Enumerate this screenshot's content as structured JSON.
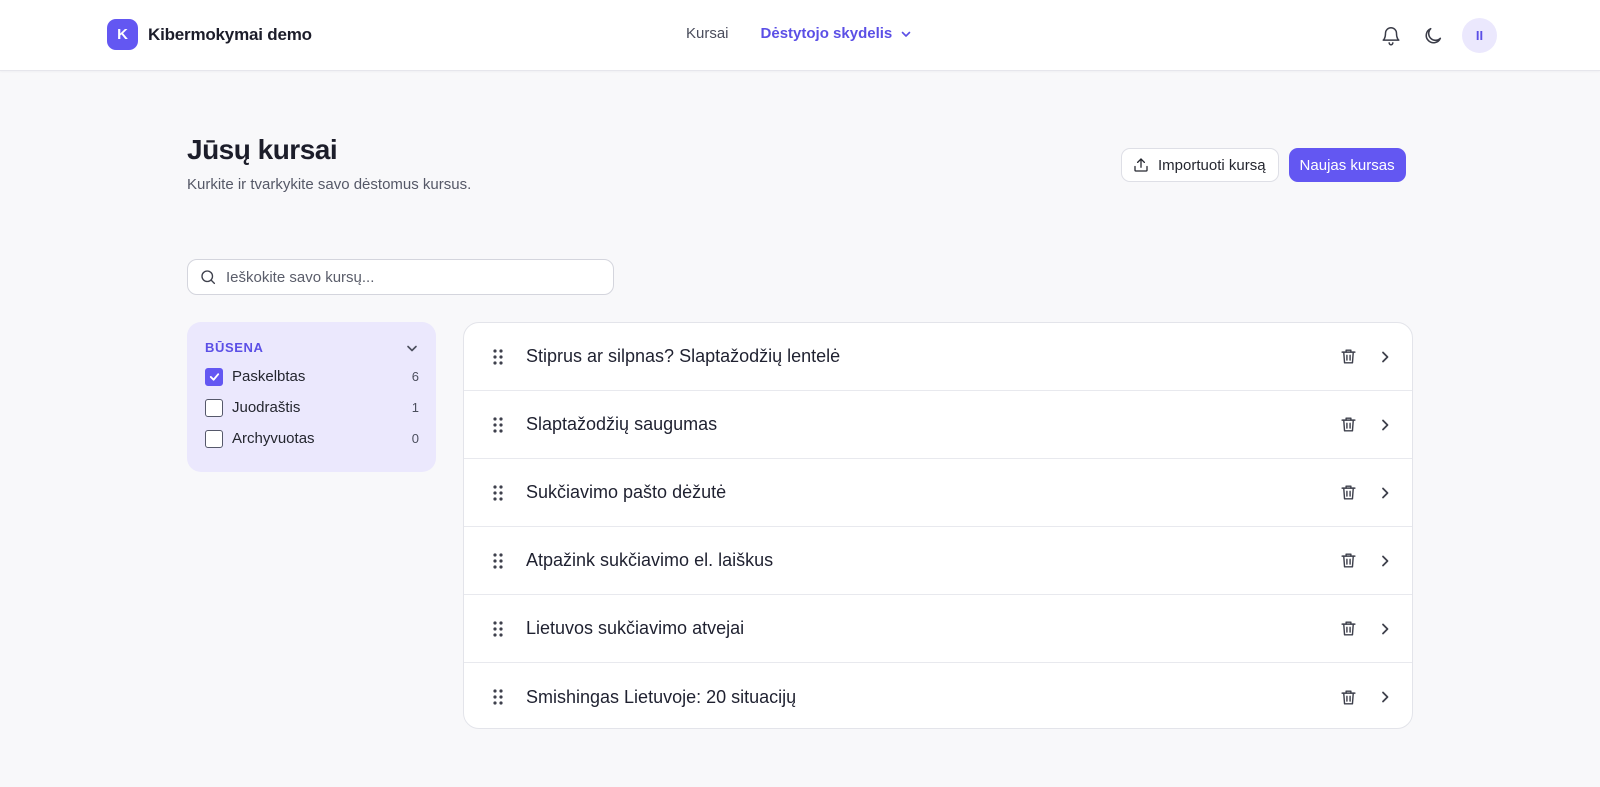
{
  "header": {
    "brand_initial": "K",
    "brand_name": "Kibermokymai demo",
    "nav": {
      "courses": "Kursai",
      "teacher_dashboard": "Dėstytojo skydelis"
    },
    "icons": [
      "bell-icon",
      "moon-icon"
    ],
    "avatar_initials": "II"
  },
  "page": {
    "title": "Jūsų kursai",
    "subtitle": "Kurkite ir tvarkykite savo dėstomus kursus.",
    "import_button": "Importuoti kursą",
    "new_button": "Naujas kursas"
  },
  "search": {
    "placeholder": "Ieškokite savo kursų..."
  },
  "filter": {
    "title": "BŪSENA",
    "options": [
      {
        "label": "Paskelbtas",
        "count": "6",
        "checked": true
      },
      {
        "label": "Juodraštis",
        "count": "1",
        "checked": false
      },
      {
        "label": "Archyvuotas",
        "count": "0",
        "checked": false
      }
    ]
  },
  "courses": [
    {
      "title": "Stiprus ar silpnas? Slaptažodžių lentelė"
    },
    {
      "title": "Slaptažodžių saugumas"
    },
    {
      "title": "Sukčiavimo pašto dėžutė"
    },
    {
      "title": "Atpažink sukčiavimo el. laiškus"
    },
    {
      "title": "Lietuvos sukčiavimo atvejai"
    },
    {
      "title": "Smishingas Lietuvoje: 20 situacijų"
    }
  ],
  "colors": {
    "accent": "#6357f2",
    "accent_soft": "#ebe8fd",
    "background": "#f8f8fa"
  }
}
